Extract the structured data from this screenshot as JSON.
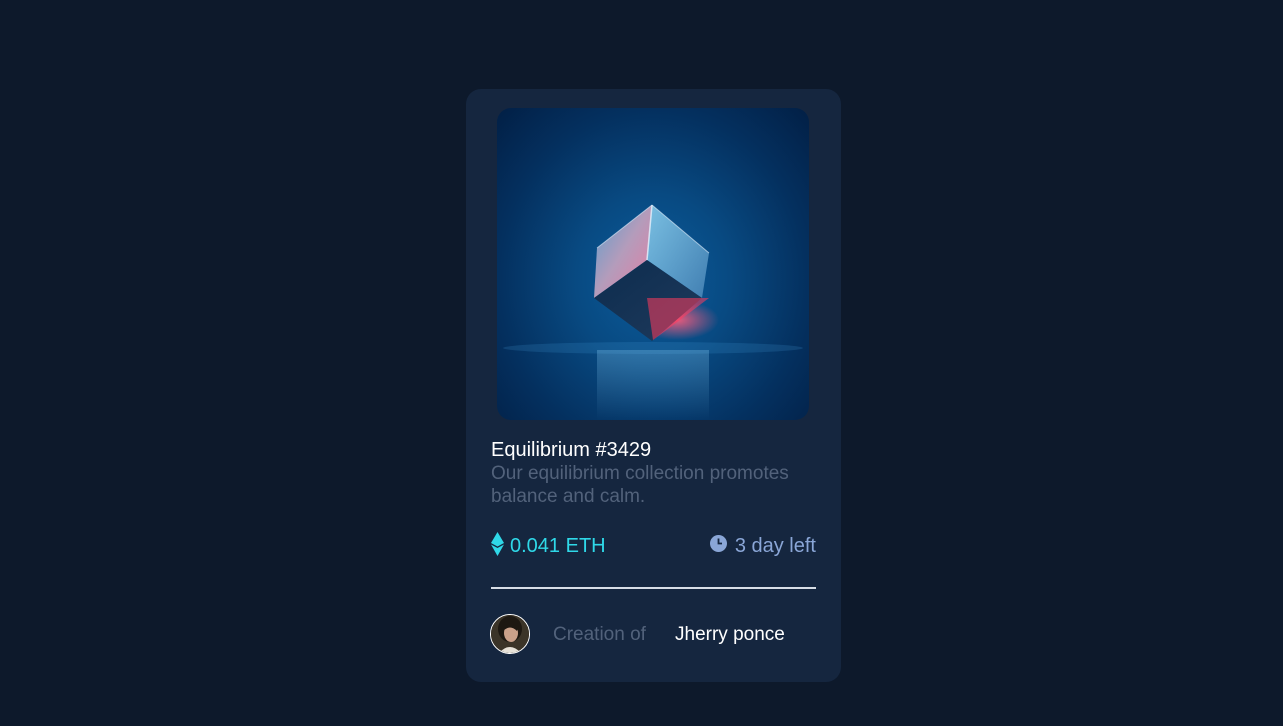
{
  "card": {
    "title": "Equilibrium #3429",
    "description": "Our equilibrium collection promotes balance and calm.",
    "price": "0.041 ETH",
    "time_left": "3 day left",
    "creation_label": "Creation of",
    "creator_name": "Jherry ponce"
  },
  "icons": {
    "price": "ethereum-icon",
    "time": "clock-icon"
  },
  "colors": {
    "page_background": "#0d192b",
    "card_background": "#15263f",
    "accent_cyan": "#2fd8e8",
    "muted_blue": "#8aa6d7",
    "muted_text": "#52627b"
  }
}
